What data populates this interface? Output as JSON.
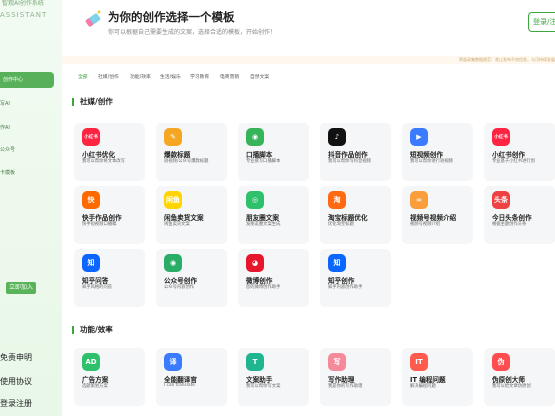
{
  "sidebar": {
    "brand": "智观AI创作系统",
    "brand_sub": "ASSISTANT",
    "active_item": "创作中心",
    "items": [
      "写AI",
      "作AI",
      "公众号",
      "卡模板"
    ],
    "join_label": "立即加入",
    "links": [
      "免责申明",
      "使用协议",
      "登录注册"
    ]
  },
  "header": {
    "title": "为你的创作选择一个模板",
    "subtitle": "你可以根据自己需要生成的文案，选择合适的模板，开始创作！",
    "login_label": "登录/注册",
    "notice": "界面采集数据规范：禁止发布不良信息，与可持续发展"
  },
  "tabs": [
    "全部",
    "社媒/创作",
    "功能/效率",
    "生活/娱乐",
    "学习教育",
    "电商营销",
    "自然文案"
  ],
  "sections": [
    {
      "title": "社媒/创作",
      "cards": [
        {
          "title": "小红书优化",
          "desc": "我可以帮你将文本改写",
          "icon": "小红书",
          "color": "#ff2442"
        },
        {
          "title": "爆款标题",
          "desc": "短视频/公众号爆款标题",
          "icon": "✎",
          "color": "#f5a623"
        },
        {
          "title": "口播脚本",
          "desc": "专业撰写口播脚本",
          "icon": "◉",
          "color": "#37b35a"
        },
        {
          "title": "抖音作品创作",
          "desc": "我可以帮你写抖音视频",
          "icon": "♪",
          "color": "#111111"
        },
        {
          "title": "短视频创作",
          "desc": "我可以帮你进行短视频",
          "icon": "▶",
          "color": "#3a7bff"
        },
        {
          "title": "小红书创作",
          "desc": "专业基于小红书进行创",
          "icon": "小红书",
          "color": "#ff2442"
        },
        {
          "title": "快手作品创作",
          "desc": "快手短视频口播稿",
          "icon": "快",
          "color": "#ff6a00"
        },
        {
          "title": "闲鱼卖货文案",
          "desc": "闲鱼卖货文案",
          "icon": "闲鱼",
          "color": "#ffd400"
        },
        {
          "title": "朋友圈文案",
          "desc": "发朋友圈文案生成",
          "icon": "◎",
          "color": "#2ec06b"
        },
        {
          "title": "淘宝标题优化",
          "desc": "优化淘宝标题",
          "icon": "淘",
          "color": "#ff6a13"
        },
        {
          "title": "视频号视频介绍",
          "desc": "视频号视频介绍",
          "icon": "∞",
          "color": "#fa9d3b"
        },
        {
          "title": "今日头条创作",
          "desc": "根据主题创作头条",
          "icon": "头条",
          "color": "#f04142"
        },
        {
          "title": "知乎问答",
          "desc": "知乎风格的问答",
          "icon": "知",
          "color": "#0a66ff"
        },
        {
          "title": "公众号创作",
          "desc": "公众号内容创作",
          "icon": "◉",
          "color": "#2aae67"
        },
        {
          "title": "微博创作",
          "desc": "您的微博创作助手",
          "icon": "◕",
          "color": "#e6162d"
        },
        {
          "title": "知乎创作",
          "desc": "知乎内容创作助手",
          "icon": "知",
          "color": "#0a66ff"
        }
      ]
    },
    {
      "title": "功能/效率",
      "cards": [
        {
          "title": "广告方案",
          "desc": "选题策划方案",
          "icon": "AD",
          "color": "#2ec06b"
        },
        {
          "title": "全能翻译官",
          "desc": "I can translate",
          "icon": "译",
          "color": "#3a7bff"
        },
        {
          "title": "文案助手",
          "desc": "我可以帮你写文案",
          "icon": "T",
          "color": "#1fb58f"
        },
        {
          "title": "写作助理",
          "desc": "我是你的写作助理",
          "icon": "写",
          "color": "#f58a9a"
        },
        {
          "title": "IT 编程问题",
          "desc": "解决编程问题",
          "icon": "IT",
          "color": "#ff5a4e"
        },
        {
          "title": "伪原创大师",
          "desc": "我可以给文章伪原创",
          "icon": "伪",
          "color": "#ff4d4f"
        }
      ]
    }
  ]
}
